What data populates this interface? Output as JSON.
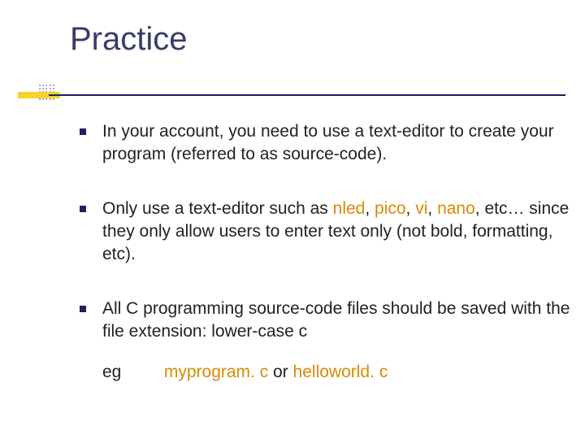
{
  "title": "Practice",
  "bullets": {
    "b1": "In your account, you need to use a text-editor to create your program (referred to as source-code).",
    "b2_pre": "Only use a text-editor such as ",
    "b2_e1": "nled",
    "b2_s1": ", ",
    "b2_e2": "pico",
    "b2_s2": ", ",
    "b2_e3": "vi",
    "b2_s3": ", ",
    "b2_e4": "nano",
    "b2_post": ", etc… since they only allow users to enter text only (not bold, formatting, etc).",
    "b3": "All C programming source-code files should be saved with the file extension: lower-case c"
  },
  "example": {
    "label": "eg",
    "file1": "myprogram. c",
    "sep": "  or  ",
    "file2": "helloworld. c"
  }
}
